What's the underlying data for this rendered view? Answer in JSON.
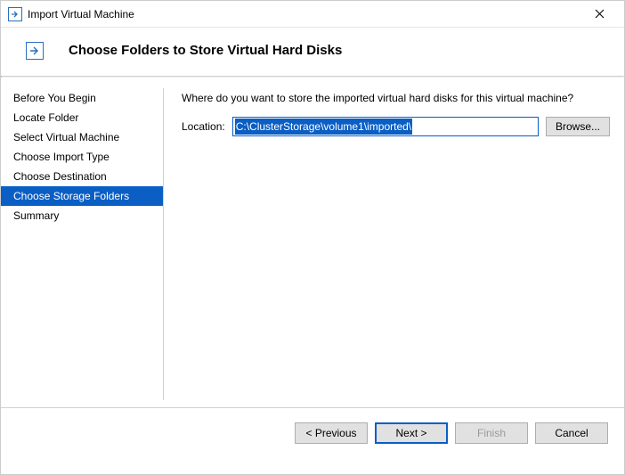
{
  "window": {
    "title": "Import Virtual Machine"
  },
  "header": {
    "title": "Choose Folders to Store Virtual Hard Disks"
  },
  "sidebar": {
    "steps": [
      "Before You Begin",
      "Locate Folder",
      "Select Virtual Machine",
      "Choose Import Type",
      "Choose Destination",
      "Choose Storage Folders",
      "Summary"
    ],
    "active_index": 5
  },
  "main": {
    "prompt": "Where do you want to store the imported virtual hard disks for this virtual machine?",
    "location_label": "Location:",
    "location_value": "C:\\ClusterStorage\\volume1\\imported\\",
    "browse_label": "Browse..."
  },
  "footer": {
    "previous": "< Previous",
    "next": "Next >",
    "finish": "Finish",
    "cancel": "Cancel"
  }
}
